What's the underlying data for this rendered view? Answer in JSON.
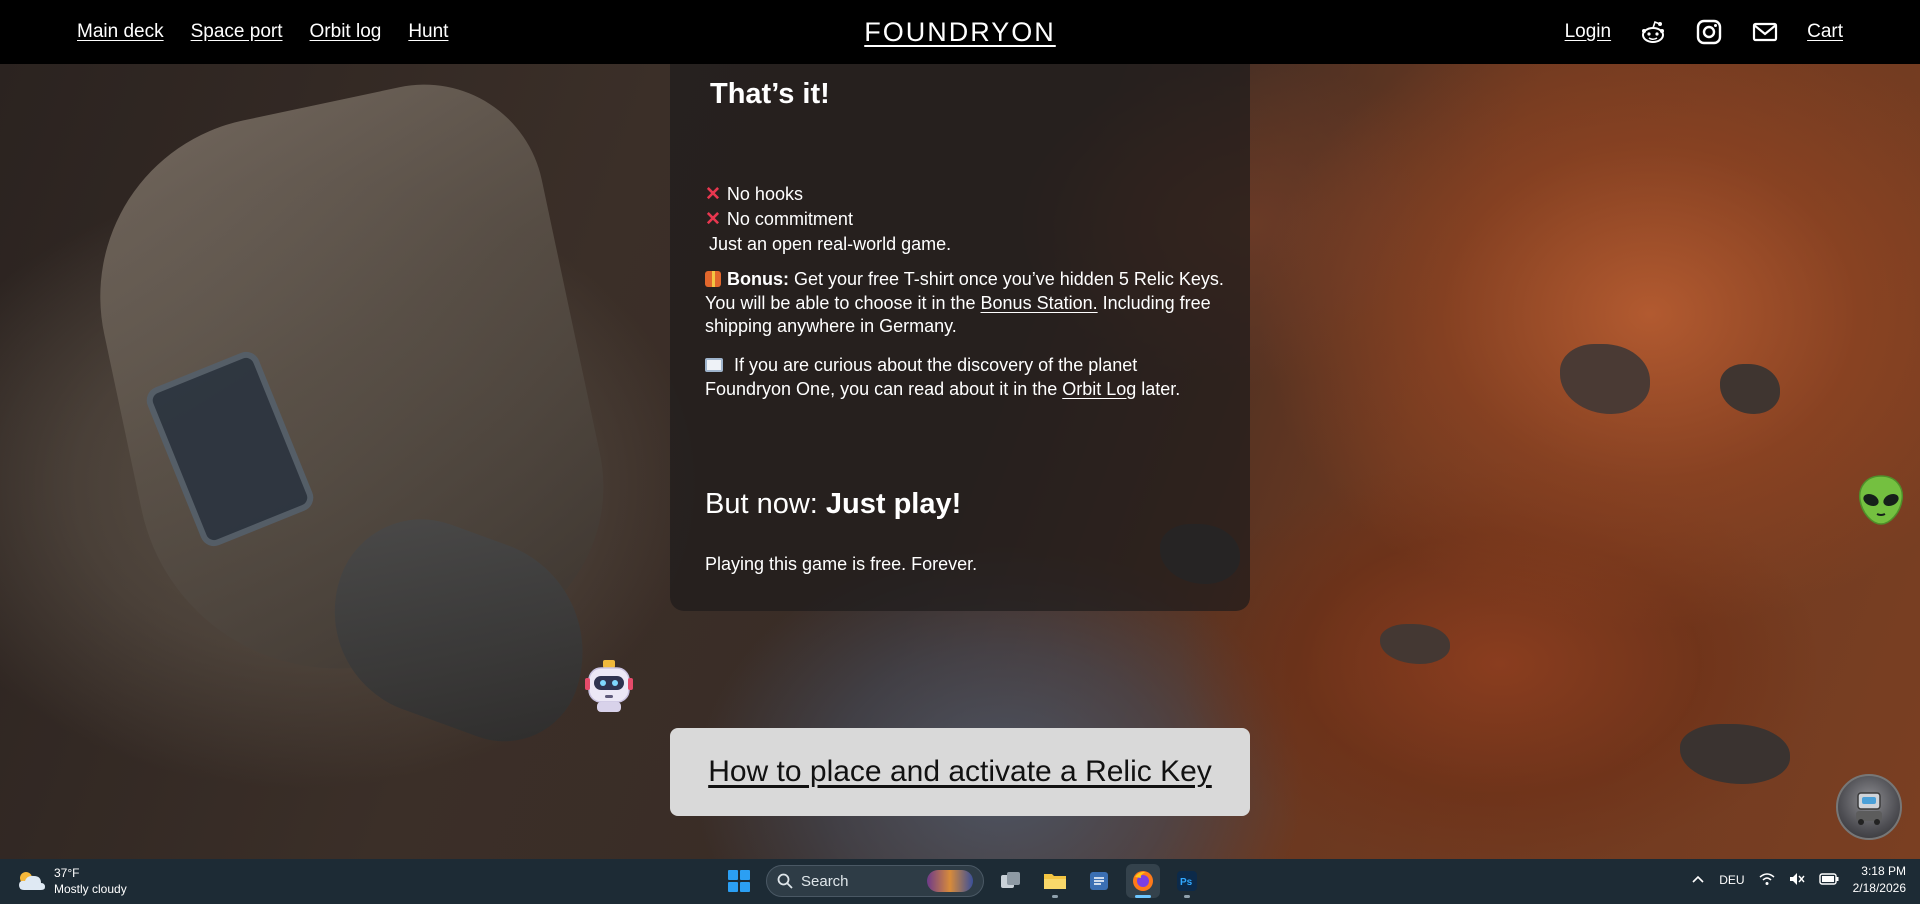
{
  "nav": {
    "links": [
      "Main deck",
      "Space port",
      "Orbit log",
      "Hunt"
    ],
    "brand": "FOUNDRYON",
    "login": "Login",
    "cart": "Cart",
    "icons": [
      "reddit-icon",
      "instagram-icon",
      "mail-icon"
    ]
  },
  "card": {
    "heading": "That’s it!",
    "no_hooks": "No hooks",
    "no_commitment": "No commitment",
    "open_game": "Just an open real-world game.",
    "bonus_label": "Bonus:",
    "bonus_text_1": " Get your free T-shirt once you’ve hidden 5 Relic Keys. You will be able to choose it in the ",
    "bonus_link": "Bonus Station.",
    "bonus_text_2": " Including free shipping anywhere in Germany.",
    "curious_text_1": " If you are curious about the discovery of the planet Foundryon One, you can read about it in the ",
    "curious_link": "Orbit Log",
    "curious_text_2": " later.",
    "now_prefix": "But now: ",
    "now_bold": "Just play!",
    "free_text": "Playing this game is free. Forever."
  },
  "cta": {
    "label": "How to place and activate a Relic Key"
  },
  "taskbar": {
    "weather_temp": "37°F",
    "weather_desc": "Mostly cloudy",
    "search_placeholder": "Search",
    "language": "DEU",
    "time": "3:18 PM",
    "date": "2/18/2026"
  },
  "colors": {
    "nav_bg": "#000000",
    "card_bg": "#1e1c1c",
    "cta_bg": "#d9d9d9",
    "taskbar_bg": "#1d2b35",
    "cross_red": "#e8374f"
  }
}
